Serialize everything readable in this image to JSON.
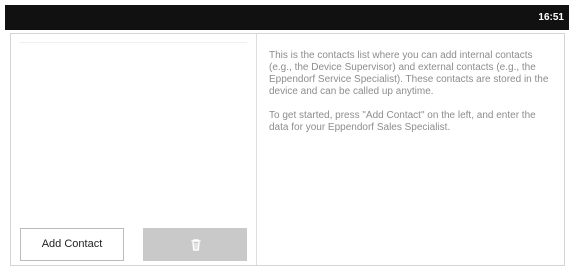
{
  "status_bar": {
    "time": "16:51"
  },
  "contacts": {
    "add_contact_label": "Add Contact",
    "delete_icon": "trash-icon"
  },
  "info": {
    "paragraph_1": "This is the contacts list where you can add internal contacts (e.g., the Device Supervisor) and external contacts (e.g., the Eppendorf Service Specialist). These contacts are stored in the device and can be called up anytime.",
    "paragraph_2": "To get started, press \"Add Contact\" on the left, and enter the data for your Eppendorf Sales Specialist."
  },
  "colors": {
    "status_bar": "#111111",
    "text_secondary": "#8d8d8d",
    "button_disabled": "#c9c9c9",
    "border": "#d5d5d5"
  }
}
